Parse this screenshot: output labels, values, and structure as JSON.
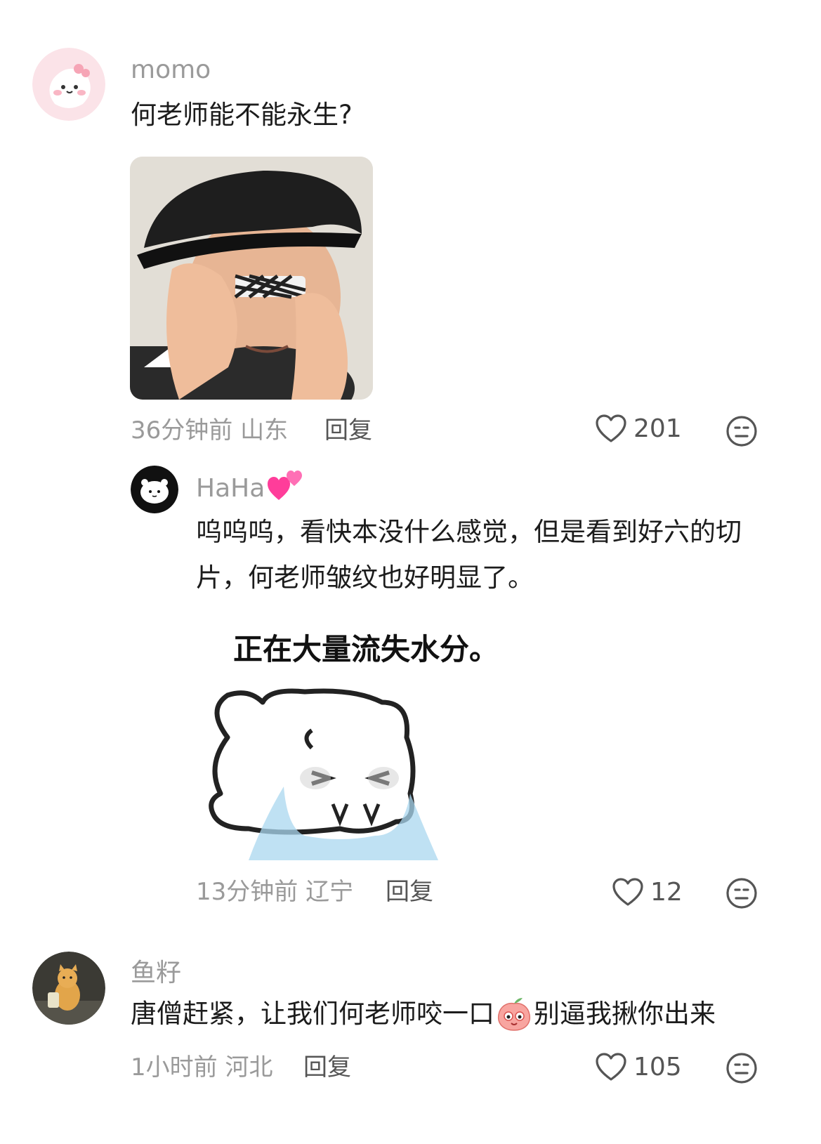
{
  "comments": [
    {
      "username": "momo",
      "text": "何老师能不能永生?",
      "time": "36分钟前",
      "location": "山东",
      "reply_label": "回复",
      "likes": "201"
    },
    {
      "username": "HaHa",
      "text": "呜呜呜，看快本没什么感觉，但是看到好六的切片，何老师皱纹也好明显了。",
      "sticker_caption": "正在大量流失水分。",
      "time": "13分钟前",
      "location": "辽宁",
      "reply_label": "回复",
      "likes": "12"
    },
    {
      "username": "鱼籽",
      "text_before_emoji": "唐僧赶紧，让我们何老师咬一口",
      "text_after_emoji": "别逼我揪你出来",
      "time": "1小时前",
      "location": "河北",
      "reply_label": "回复",
      "likes": "105"
    }
  ],
  "icons": {
    "like": "heart-outline-icon",
    "dislike": "neutral-face-icon",
    "emoji_hearts": "two-hearts-emoji",
    "emoji_inline": "peach-cry-emoji"
  },
  "colors": {
    "username": "#9a9a9a",
    "text": "#1c1c1c",
    "meta": "#9a9a9a",
    "pink": "#ff4fa3"
  }
}
